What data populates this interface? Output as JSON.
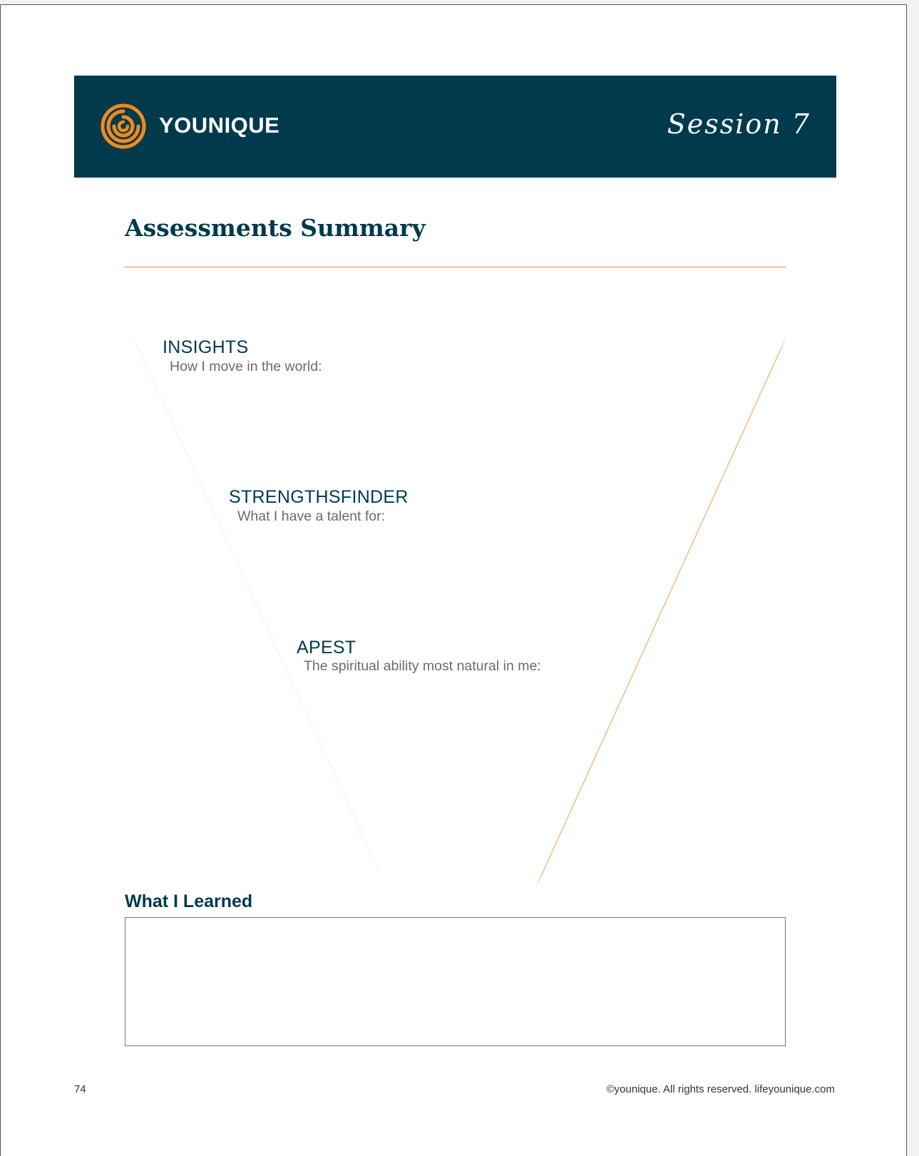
{
  "header": {
    "brand_name": "YOUNIQUE",
    "logo_icon": "spiral-logo-icon",
    "session_label": "Session 7"
  },
  "page_title": "Assessments Summary",
  "sections": [
    {
      "heading": "INSIGHTS",
      "prompt": "How I move in the world:"
    },
    {
      "heading": "STRENGTHSFINDER",
      "prompt": "What I have a talent for:"
    },
    {
      "heading": "APEST",
      "prompt": "The spiritual ability most natural in me:"
    }
  ],
  "learned": {
    "heading": "What I Learned"
  },
  "footer": {
    "page_number": "74",
    "copyright": "©younique. All rights reserved. lifeyounique.com"
  },
  "colors": {
    "brand_navy": "#003a4c",
    "accent_orange": "#f08a2c",
    "funnel_orange": "#f07d12"
  }
}
